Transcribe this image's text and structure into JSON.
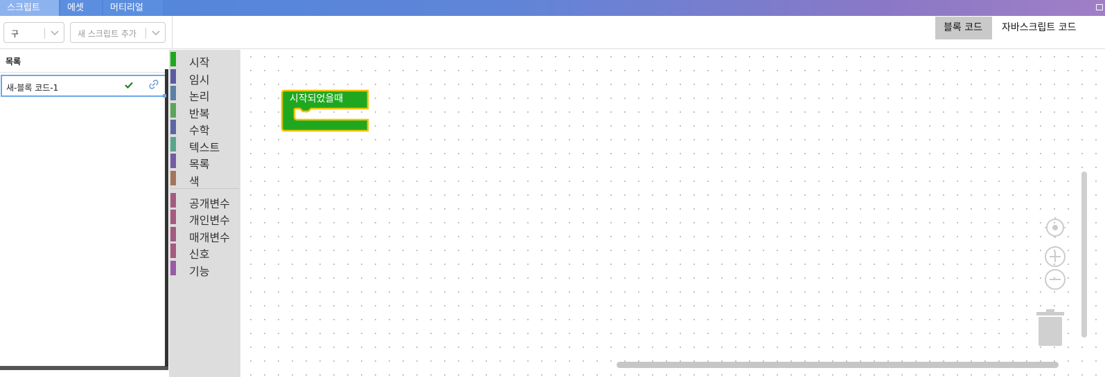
{
  "top_tabs": [
    {
      "label": "스크립트",
      "active": true
    },
    {
      "label": "에셋",
      "active": false
    },
    {
      "label": "머티리얼",
      "active": false
    }
  ],
  "toolbar": {
    "select_value": "구",
    "add_script_placeholder": "새 스크립트 추가",
    "code_tabs": [
      {
        "label": "블록 코드",
        "active": true
      },
      {
        "label": "자바스크립트 코드",
        "active": false
      }
    ]
  },
  "script_list": {
    "title": "목록",
    "items": [
      {
        "name": "새-블록 코드-1"
      }
    ]
  },
  "categories": [
    {
      "label": "시작",
      "color": "#1fa81f"
    },
    {
      "label": "임시",
      "color": "#5b5ba5"
    },
    {
      "label": "논리",
      "color": "#5b80a5"
    },
    {
      "label": "반복",
      "color": "#5ba55b"
    },
    {
      "label": "수학",
      "color": "#5b67a5"
    },
    {
      "label": "텍스트",
      "color": "#5ba58c"
    },
    {
      "label": "목록",
      "color": "#745ba5"
    },
    {
      "label": "색",
      "color": "#a5745b"
    },
    {
      "label": "공개변수",
      "color": "#a55b80"
    },
    {
      "label": "개인변수",
      "color": "#a55b80"
    },
    {
      "label": "매개변수",
      "color": "#a55b80"
    },
    {
      "label": "신호",
      "color": "#a55b80"
    },
    {
      "label": "기능",
      "color": "#995ba5"
    }
  ],
  "workspace": {
    "event_block": {
      "label": "시작되었을때",
      "fill": "#1fa81f",
      "outline": "#f2c300"
    }
  },
  "colors": {
    "accent_blue": "#6aa8e8",
    "workspace_bg": "#ffffff",
    "toolbox_bg": "#dddddd"
  }
}
